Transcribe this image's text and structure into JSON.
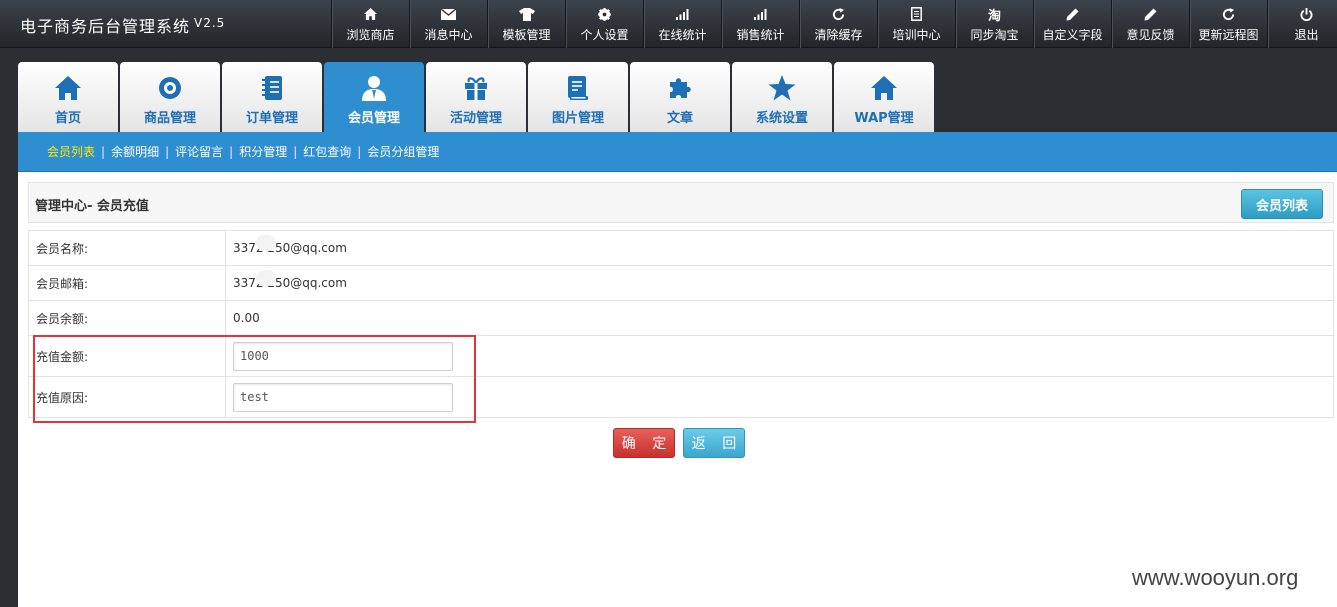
{
  "app": {
    "title": "电子商务后台管理系统",
    "version": "V2.5"
  },
  "topnav": [
    {
      "label": "浏览商店",
      "icon": "home-icon"
    },
    {
      "label": "消息中心",
      "icon": "envelope-icon"
    },
    {
      "label": "模板管理",
      "icon": "tshirt-icon"
    },
    {
      "label": "个人设置",
      "icon": "gear-icon"
    },
    {
      "label": "在线统计",
      "icon": "signal-icon"
    },
    {
      "label": "销售统计",
      "icon": "signal-icon"
    },
    {
      "label": "清除缓存",
      "icon": "refresh-icon"
    },
    {
      "label": "培训中心",
      "icon": "document-icon"
    },
    {
      "label": "同步淘宝",
      "icon": "taobao-icon",
      "glyph": "淘"
    },
    {
      "label": "自定义字段",
      "icon": "pencil-icon"
    },
    {
      "label": "意见反馈",
      "icon": "pencil-icon"
    },
    {
      "label": "更新远程图",
      "icon": "refresh-icon"
    },
    {
      "label": "退出",
      "icon": "power-icon"
    }
  ],
  "tabs": [
    {
      "label": "首页",
      "icon": "home-icon",
      "active": false
    },
    {
      "label": "商品管理",
      "icon": "disc-icon",
      "active": false
    },
    {
      "label": "订单管理",
      "icon": "notebook-icon",
      "active": false
    },
    {
      "label": "会员管理",
      "icon": "user-icon",
      "active": true
    },
    {
      "label": "活动管理",
      "icon": "gift-icon",
      "active": false
    },
    {
      "label": "图片管理",
      "icon": "book-icon",
      "active": false
    },
    {
      "label": "文章",
      "icon": "puzzle-icon",
      "active": false
    },
    {
      "label": "系统设置",
      "icon": "star-icon",
      "active": false
    },
    {
      "label": "WAP管理",
      "icon": "home-icon",
      "active": false
    }
  ],
  "subnav": [
    {
      "label": "会员列表",
      "active": true
    },
    {
      "label": "余额明细",
      "active": false
    },
    {
      "label": "评论留言",
      "active": false
    },
    {
      "label": "积分管理",
      "active": false
    },
    {
      "label": "红包查询",
      "active": false
    },
    {
      "label": "会员分组管理",
      "active": false
    }
  ],
  "panel": {
    "title": "管理中心- 会员充值",
    "list_button": "会员列表"
  },
  "form": {
    "member_name": {
      "label": "会员名称:",
      "value": "3372    250@qq.com"
    },
    "member_email": {
      "label": "会员邮箱:",
      "value": "3372    250@qq.com"
    },
    "member_balance": {
      "label": "会员余额:",
      "value": "0.00"
    },
    "recharge_amount": {
      "label": "充值金额:",
      "value": "1000"
    },
    "recharge_reason": {
      "label": "充值原因:",
      "value": "test"
    }
  },
  "buttons": {
    "confirm": "确 定",
    "back": "返 回"
  },
  "watermark": "www.wooyun.org",
  "colors": {
    "accent": "#2f8ed0",
    "highlight": "#e0353a",
    "confirm": "#d9443f",
    "back": "#4ab3db"
  }
}
